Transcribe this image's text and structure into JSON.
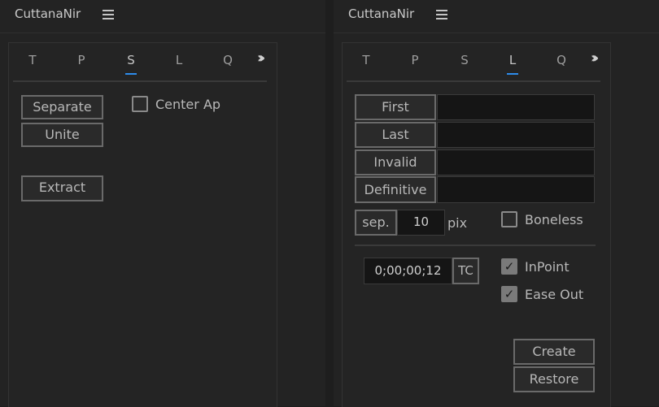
{
  "left_panel": {
    "app_title": "CuttanaNir",
    "menu_icon": "hamburger-menu-icon",
    "more_icon": "double-chevron-right-icon",
    "tabs": [
      "T",
      "P",
      "S",
      "L",
      "Q"
    ],
    "active_tab": "S",
    "accent_color": "#2d8ceb",
    "buttons": {
      "separate": "Separate",
      "unite": "Unite",
      "extract": "Extract"
    },
    "center_ap": {
      "label": "Center Ap",
      "checked": false
    }
  },
  "right_panel": {
    "app_title": "CuttanaNir",
    "menu_icon": "hamburger-menu-icon",
    "more_icon": "double-chevron-right-icon",
    "tabs": [
      "T",
      "P",
      "S",
      "L",
      "Q"
    ],
    "active_tab": "L",
    "rows": [
      {
        "button": "First",
        "value": ""
      },
      {
        "button": "Last",
        "value": ""
      },
      {
        "button": "Invalid",
        "value": ""
      },
      {
        "button": "Definitive",
        "value": ""
      }
    ],
    "sep": {
      "button": "sep.",
      "value": "10",
      "unit": "pix"
    },
    "boneless": {
      "label": "Boneless",
      "checked": false
    },
    "timecode": {
      "value": "0;00;00;12",
      "button": "TC"
    },
    "inpoint": {
      "label": "InPoint",
      "checked": true
    },
    "ease_out": {
      "label": "Ease Out",
      "checked": true
    },
    "buttons": {
      "create": "Create",
      "restore": "Restore"
    }
  }
}
